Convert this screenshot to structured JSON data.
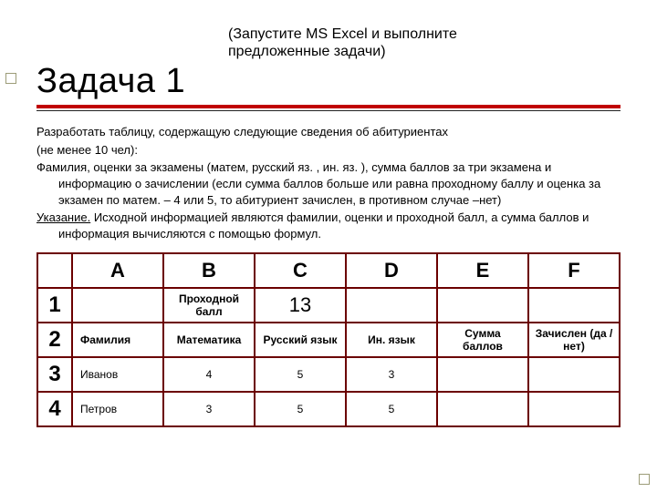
{
  "header": {
    "note_l1": "(Запустите MS Excel и выполните",
    "note_l2": "предложенные задачи)",
    "title": "Задача 1"
  },
  "body": {
    "p1a": "Разработать таблицу, содержащую следующие сведения об абитуриентах",
    "p1b": "(не менее 10 чел):",
    "p2": "Фамилия, оценки за экзамены (матем, русский яз. , ин. яз. ), сумма баллов за три экзамена и информацию о зачислении (если сумма баллов больше или равна проходному баллу и оценка за экзамен по матем. – 4 или 5, то абитуриент зачислен, в противном случае –нет)",
    "p3_lead": "Указание.",
    "p3_rest": " Исходной информацией являются фамилии, оценки и проходной балл, а сумма баллов и информация вычисляются с помощью формул."
  },
  "table": {
    "cols": [
      "A",
      "B",
      "C",
      "D",
      "E",
      "F"
    ],
    "row1": {
      "b": "Проходной балл",
      "c": "13"
    },
    "row2": {
      "a": "Фамилия",
      "b": "Математика",
      "c": "Русский язык",
      "d": "Ин. язык",
      "e": "Сумма баллов",
      "f": "Зачислен (да /нет)"
    },
    "row3": {
      "a": "Иванов",
      "b": "4",
      "c": "5",
      "d": "3",
      "e": "",
      "f": ""
    },
    "row4": {
      "a": "Петров",
      "b": "3",
      "c": "5",
      "d": "5",
      "e": "",
      "f": ""
    }
  },
  "chart_data": {
    "type": "table",
    "title": "Задача 1 — пример таблицы абитуриентов",
    "columns": [
      "",
      "A",
      "B",
      "C",
      "D",
      "E",
      "F"
    ],
    "rows": [
      [
        "1",
        "",
        "Проходной балл",
        "13",
        "",
        "",
        ""
      ],
      [
        "2",
        "Фамилия",
        "Математика",
        "Русский язык",
        "Ин. язык",
        "Сумма баллов",
        "Зачислен (да /нет)"
      ],
      [
        "3",
        "Иванов",
        "4",
        "5",
        "3",
        "",
        ""
      ],
      [
        "4",
        "Петров",
        "3",
        "5",
        "5",
        "",
        ""
      ]
    ]
  }
}
